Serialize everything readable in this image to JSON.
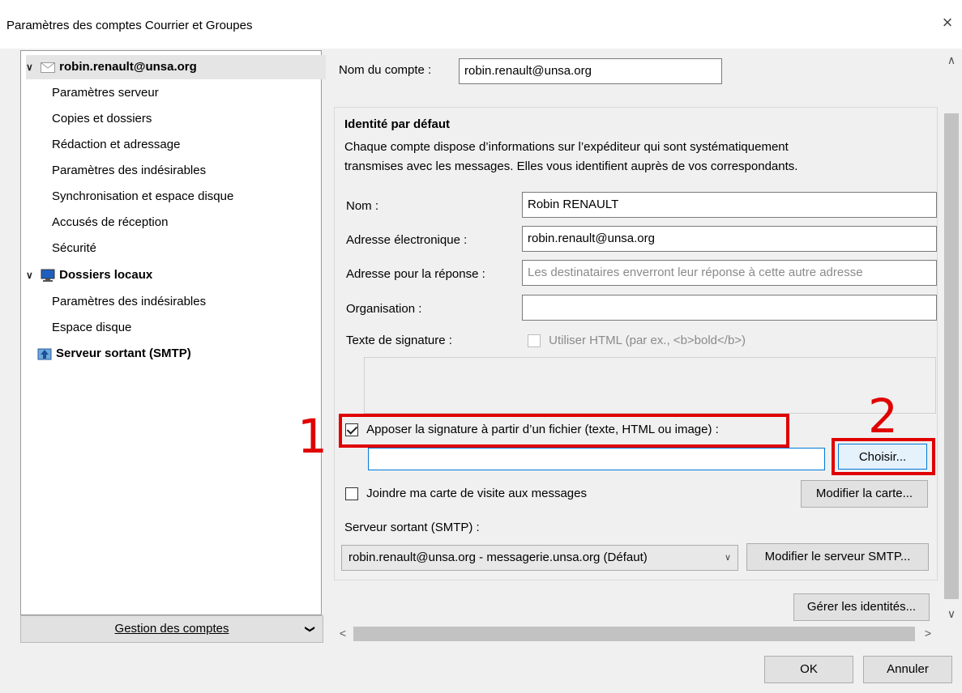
{
  "window": {
    "title": "Paramètres des comptes Courrier et Groupes",
    "close_icon": "×"
  },
  "tree": {
    "account": "robin.renault@unsa.org",
    "account_children": [
      "Paramètres serveur",
      "Copies et dossiers",
      "Rédaction et adressage",
      "Paramètres des indésirables",
      "Synchronisation et espace disque",
      "Accusés de réception",
      "Sécurité"
    ],
    "local": "Dossiers locaux",
    "local_children": [
      "Paramètres des indésirables",
      "Espace disque"
    ],
    "smtp": "Serveur sortant (SMTP)"
  },
  "manage": {
    "label": "Gestion des comptes",
    "arrow": "❯"
  },
  "account_name": {
    "label": "Nom du compte :",
    "value": "robin.renault@unsa.org"
  },
  "identity": {
    "heading": "Identité par défaut",
    "desc1": "Chaque compte dispose d’informations sur l’expéditeur qui sont systématiquement",
    "desc2": "transmises avec les messages. Elles vous identifient auprès de vos correspondants.",
    "name_label": "Nom :",
    "name_value": "Robin RENAULT",
    "email_label": "Adresse électronique :",
    "email_value": "robin.renault@unsa.org",
    "reply_label": "Adresse pour la réponse :",
    "reply_placeholder": "Les destinataires enverront leur réponse à cette autre adresse",
    "org_label": "Organisation :",
    "org_value": "",
    "sig_label": "Texte de signature :",
    "html_label": "Utiliser HTML (par ex., <b>bold</b>)",
    "attach_sig_label": "Apposer la signature à partir d’un fichier (texte, HTML ou image) :",
    "attach_sig_checked": true,
    "sig_file_value": "",
    "choose_label": "Choisir...",
    "vcard_label": "Joindre ma carte de visite aux messages",
    "vcard_checked": false,
    "edit_card_label": "Modifier la carte...",
    "smtp_label": "Serveur sortant (SMTP) :",
    "smtp_value": "robin.renault@unsa.org - messagerie.unsa.org (Défaut)",
    "edit_smtp_label": "Modifier le serveur SMTP..."
  },
  "manage_identities": "Gérer les identités...",
  "annotations": {
    "num1": "1",
    "num2": "2"
  },
  "footer": {
    "ok": "OK",
    "cancel": "Annuler"
  }
}
